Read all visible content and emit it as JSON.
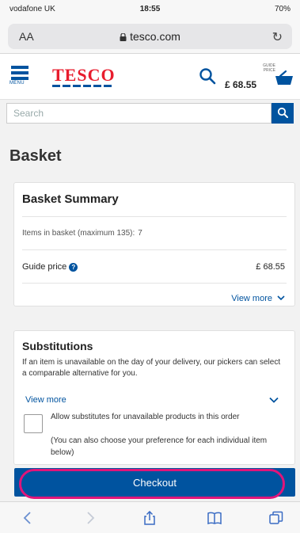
{
  "status_bar": {
    "carrier": "vodafone UK",
    "time": "18:55",
    "battery": "70%"
  },
  "address_bar": {
    "aa_label": "AA",
    "url": "tesco.com"
  },
  "header": {
    "menu_label": "MENU",
    "logo_text": "TESCO",
    "guide_price_label": "GUIDE PRICE",
    "guide_price_amount": "£ 68.55"
  },
  "search": {
    "placeholder": "Search"
  },
  "page_title": "Basket",
  "summary": {
    "title": "Basket Summary",
    "items_label": "Items in basket (maximum 135):",
    "items_count": "7",
    "guide_price_label": "Guide price",
    "guide_price_value": "£ 68.55",
    "view_more": "View more"
  },
  "substitutions": {
    "title": "Substitutions",
    "description": "If an item is unavailable on the day of your delivery, our pickers can select a comparable alternative for you.",
    "view_more": "View more",
    "checkbox_label": "Allow substitutes for unavailable products in this order",
    "checkbox_note": "(You can also choose your preference for each individual item below)"
  },
  "checkout": {
    "label": "Checkout"
  },
  "colors": {
    "tesco_blue": "#00539f",
    "tesco_red": "#e81c2d",
    "highlight": "#e0157a"
  },
  "icons": {
    "search": "search-icon",
    "basket": "basket-icon",
    "menu": "hamburger-menu-icon",
    "info": "info-icon",
    "chevron": "chevron-down-icon",
    "back": "back-arrow-icon",
    "forward": "forward-arrow-icon",
    "share": "share-icon",
    "bookmarks": "bookmarks-icon",
    "tabs": "tabs-icon"
  }
}
